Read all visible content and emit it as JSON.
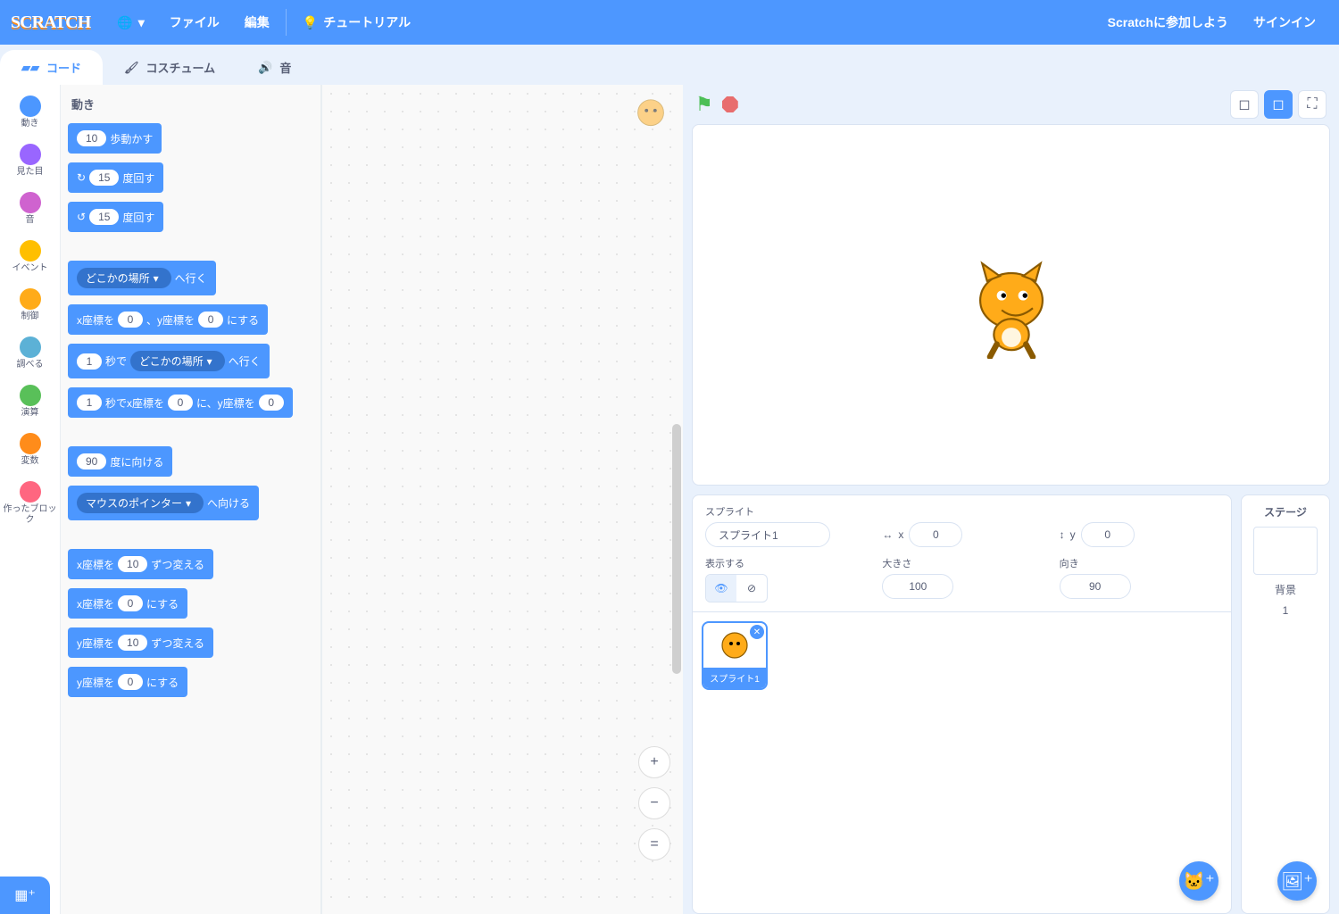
{
  "menubar": {
    "logo": "SCRATCH",
    "file": "ファイル",
    "edit": "編集",
    "tutorials": "チュートリアル",
    "join": "Scratchに参加しよう",
    "signin": "サインイン"
  },
  "tabs": {
    "code": "コード",
    "costumes": "コスチューム",
    "sounds": "音"
  },
  "categories": [
    {
      "name": "動き",
      "color": "#4c97ff"
    },
    {
      "name": "見た目",
      "color": "#9966ff"
    },
    {
      "name": "音",
      "color": "#cf63cf"
    },
    {
      "name": "イベント",
      "color": "#ffbf00"
    },
    {
      "name": "制御",
      "color": "#ffab19"
    },
    {
      "name": "調べる",
      "color": "#5cb1d6"
    },
    {
      "name": "演算",
      "color": "#59c059"
    },
    {
      "name": "変数",
      "color": "#ff8c1a"
    },
    {
      "name": "作ったブロック",
      "color": "#ff6680"
    }
  ],
  "palette": {
    "header": "動き",
    "blocks": {
      "move_steps": {
        "val": "10",
        "label": "歩動かす"
      },
      "turn_cw": {
        "val": "15",
        "label": "度回す"
      },
      "turn_ccw": {
        "val": "15",
        "label": "度回す"
      },
      "goto_menu": {
        "menu": "どこかの場所",
        "label": "へ行く"
      },
      "goto_xy": {
        "pre": "x座標を",
        "x": "0",
        "mid": "、y座標を",
        "y": "0",
        "post": "にする"
      },
      "glide_menu": {
        "secs": "1",
        "mid": "秒で",
        "menu": "どこかの場所",
        "post": "へ行く"
      },
      "glide_xy": {
        "secs": "1",
        "mid": "秒でx座標を",
        "x": "0",
        "mid2": "に、y座標を",
        "y": "0"
      },
      "point_dir": {
        "val": "90",
        "label": "度に向ける"
      },
      "point_towards": {
        "menu": "マウスのポインター",
        "label": "へ向ける"
      },
      "change_x": {
        "pre": "x座標を",
        "val": "10",
        "post": "ずつ変える"
      },
      "set_x": {
        "pre": "x座標を",
        "val": "0",
        "post": "にする"
      },
      "change_y": {
        "pre": "y座標を",
        "val": "10",
        "post": "ずつ変える"
      },
      "set_y": {
        "pre": "y座標を",
        "val": "0",
        "post": "にする"
      }
    }
  },
  "sprite_info": {
    "sprite_label": "スプライト",
    "name": "スプライト1",
    "x_label": "x",
    "x": "0",
    "y_label": "y",
    "y": "0",
    "show_label": "表示する",
    "size_label": "大きさ",
    "size": "100",
    "dir_label": "向き",
    "dir": "90"
  },
  "sprite_tile": {
    "name": "スプライト1"
  },
  "stage_selector": {
    "label": "ステージ",
    "backdrops_label": "背景",
    "count": "1"
  }
}
